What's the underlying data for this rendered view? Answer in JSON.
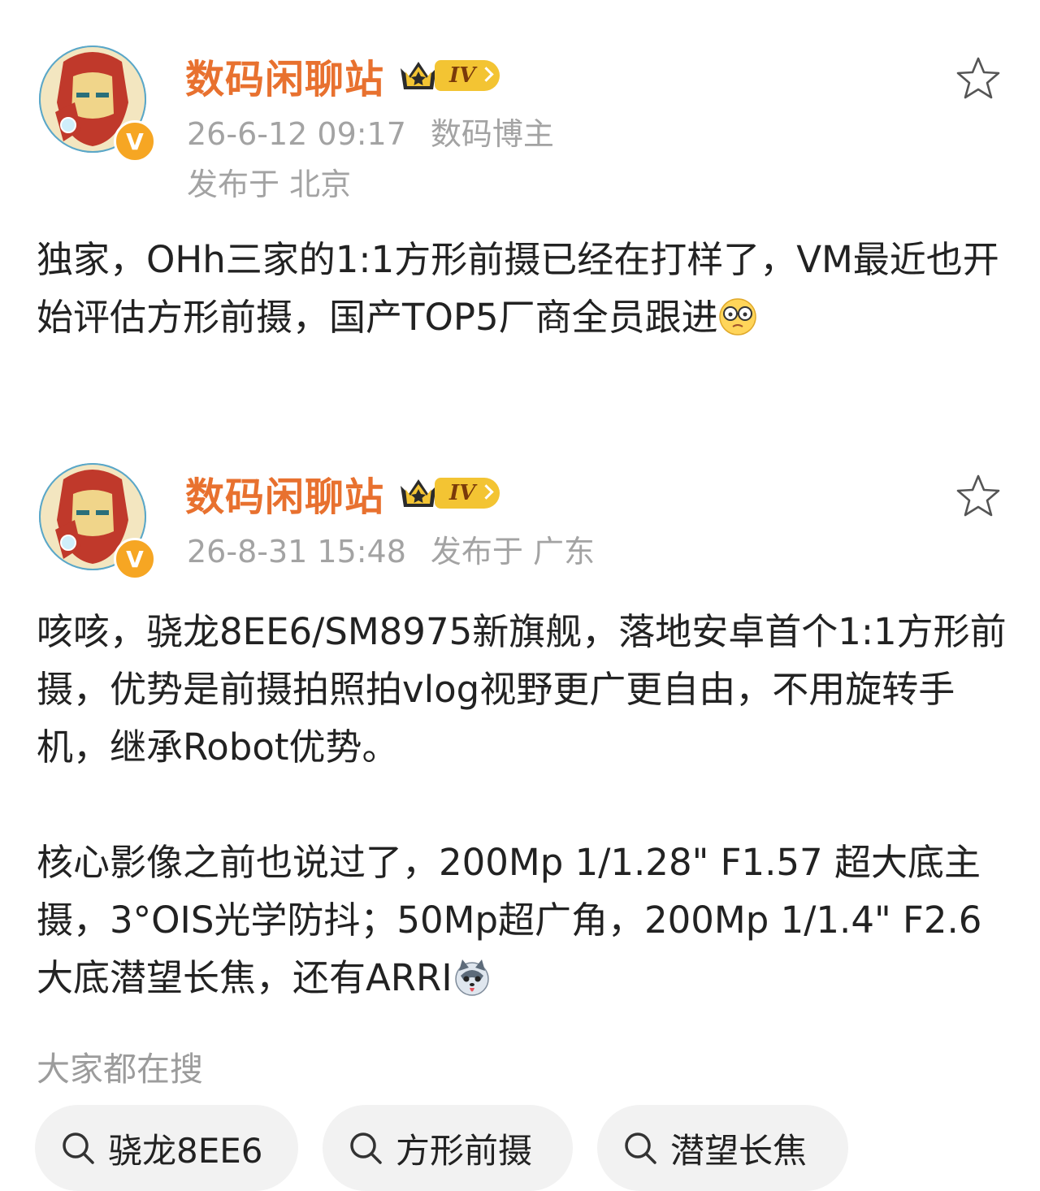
{
  "colors": {
    "name": "#e8712f",
    "meta": "#a3a3a3",
    "badge": "#f3c433",
    "chip_bg": "#f2f2f2"
  },
  "posts": [
    {
      "author": "数码闲聊站",
      "level": "IV",
      "verified_mark": "V",
      "time": "26-6-12 09:17",
      "role": "数码博主",
      "location": "发布于 北京",
      "content": "独家，OHh三家的1:1方形前摄已经在打样了，VM最近也开始评估方形前摄，国产TOP5厂商全员跟进",
      "emoji": "glasses-emoji-icon"
    },
    {
      "author": "数码闲聊站",
      "level": "IV",
      "verified_mark": "V",
      "time": "26-8-31 15:48",
      "location": "发布于 广东",
      "content": "咳咳，骁龙8EE6/SM8975新旗舰，落地安卓首个1:1方形前摄，优势是前摄拍照拍vlog视野更广更自由，不用旋转手机，继承Robot优势。\n\n核心影像之前也说过了，200Mp 1/1.28\" F1.57 超大底主摄，3°OIS光学防抖；50Mp超广角，200Mp 1/1.4\" F2.6大底潜望长焦，还有ARRI",
      "emoji": "husky-emoji-icon"
    }
  ],
  "search": {
    "title": "大家都在搜",
    "chips": [
      "骁龙8EE6",
      "方形前摄",
      "潜望长焦"
    ]
  }
}
